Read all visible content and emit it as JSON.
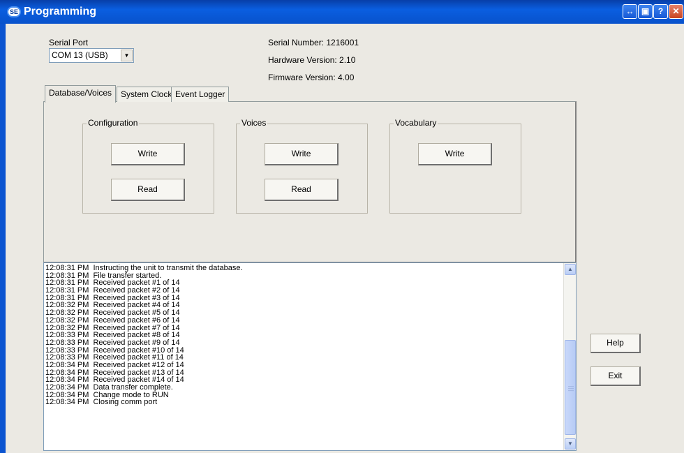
{
  "window": {
    "title": "Programming",
    "icon_name": "app-logo-icon",
    "title_buttons": [
      {
        "name": "restore-arrows-icon",
        "glyph": "↔"
      },
      {
        "name": "tile-icon",
        "glyph": "▣"
      },
      {
        "name": "help-icon",
        "glyph": "?"
      },
      {
        "name": "close-icon",
        "glyph": "✕"
      }
    ],
    "colors": {
      "titlebar": "#0a5ee0",
      "face": "#ebe9e3"
    }
  },
  "serial_port": {
    "label": "Serial Port",
    "selected": "COM 13 (USB)",
    "arrow_icon": "chevron-down-icon"
  },
  "device_info": {
    "serial_number": "Serial Number: 1216001",
    "hardware_version": "Hardware Version: 2.10",
    "firmware_version": "Firmware Version:  4.00"
  },
  "tabs": [
    {
      "label": "Database/Voices",
      "active": true
    },
    {
      "label": "System Clock",
      "active": false
    },
    {
      "label": "Event Logger",
      "active": false
    }
  ],
  "groups": {
    "configuration": {
      "title": "Configuration",
      "write_label": "Write",
      "read_label": "Read"
    },
    "voices": {
      "title": "Voices",
      "write_label": "Write",
      "read_label": "Read"
    },
    "vocabulary": {
      "title": "Vocabulary",
      "write_label": "Write"
    }
  },
  "log_lines": [
    "12:08:31 PM  Instructing the unit to transmit the database.",
    "12:08:31 PM  File transfer started.",
    "12:08:31 PM  Received packet #1 of 14",
    "12:08:31 PM  Received packet #2 of 14",
    "12:08:31 PM  Received packet #3 of 14",
    "12:08:32 PM  Received packet #4 of 14",
    "12:08:32 PM  Received packet #5 of 14",
    "12:08:32 PM  Received packet #6 of 14",
    "12:08:32 PM  Received packet #7 of 14",
    "12:08:33 PM  Received packet #8 of 14",
    "12:08:33 PM  Received packet #9 of 14",
    "12:08:33 PM  Received packet #10 of 14",
    "12:08:33 PM  Received packet #11 of 14",
    "12:08:34 PM  Received packet #12 of 14",
    "12:08:34 PM  Received packet #13 of 14",
    "12:08:34 PM  Received packet #14 of 14",
    "12:08:34 PM  Data transfer complete.",
    "12:08:34 PM  Change mode to RUN",
    "12:08:34 PM  Closing comm port"
  ],
  "side_buttons": {
    "help_label": "Help",
    "exit_label": "Exit"
  }
}
